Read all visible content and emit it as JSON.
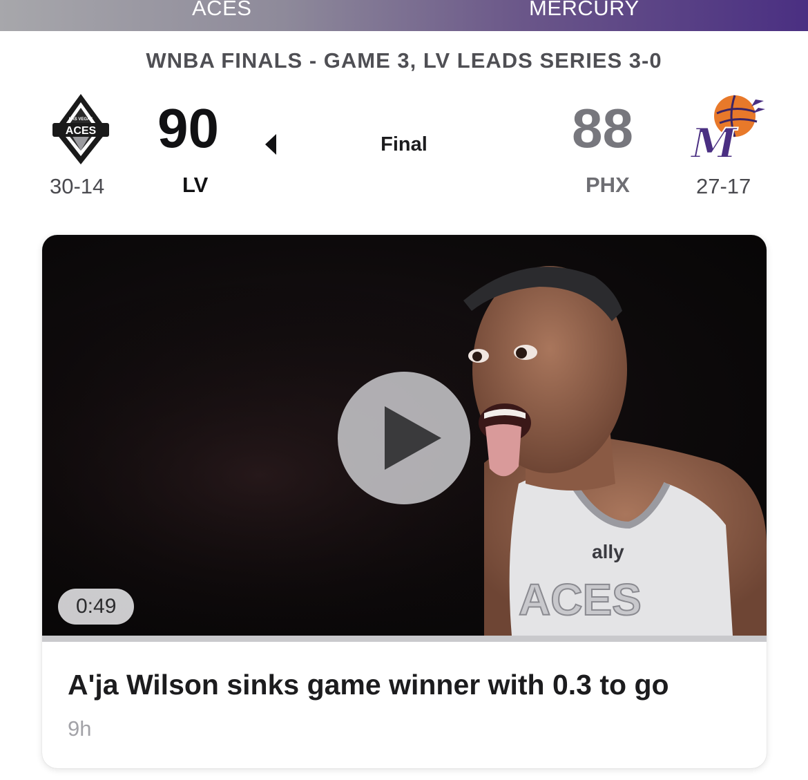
{
  "header": {
    "home_team_name": "ACES",
    "away_team_name": "MERCURY"
  },
  "game": {
    "series_text": "WNBA FINALS - GAME 3, LV LEADS SERIES 3-0",
    "status": "Final",
    "home": {
      "abbr": "LV",
      "score": "90",
      "record": "30-14",
      "logo": "las-vegas-aces-logo",
      "logo_text": "ACES",
      "logo_small_text": "LAS VEGAS"
    },
    "away": {
      "abbr": "PHX",
      "score": "88",
      "record": "27-17",
      "logo": "phoenix-mercury-logo",
      "logo_text": "M"
    },
    "winner": "home"
  },
  "video_card": {
    "duration": "0:49",
    "headline": "A'ja Wilson sinks game winner with 0.3 to go",
    "age": "9h",
    "progress": 0,
    "jersey_text": "ACES",
    "sponsor_text": "ally"
  },
  "colors": {
    "aces_gray": "#a7a7ab",
    "mercury_purple": "#4a2f82",
    "mercury_orange": "#e8792a"
  }
}
